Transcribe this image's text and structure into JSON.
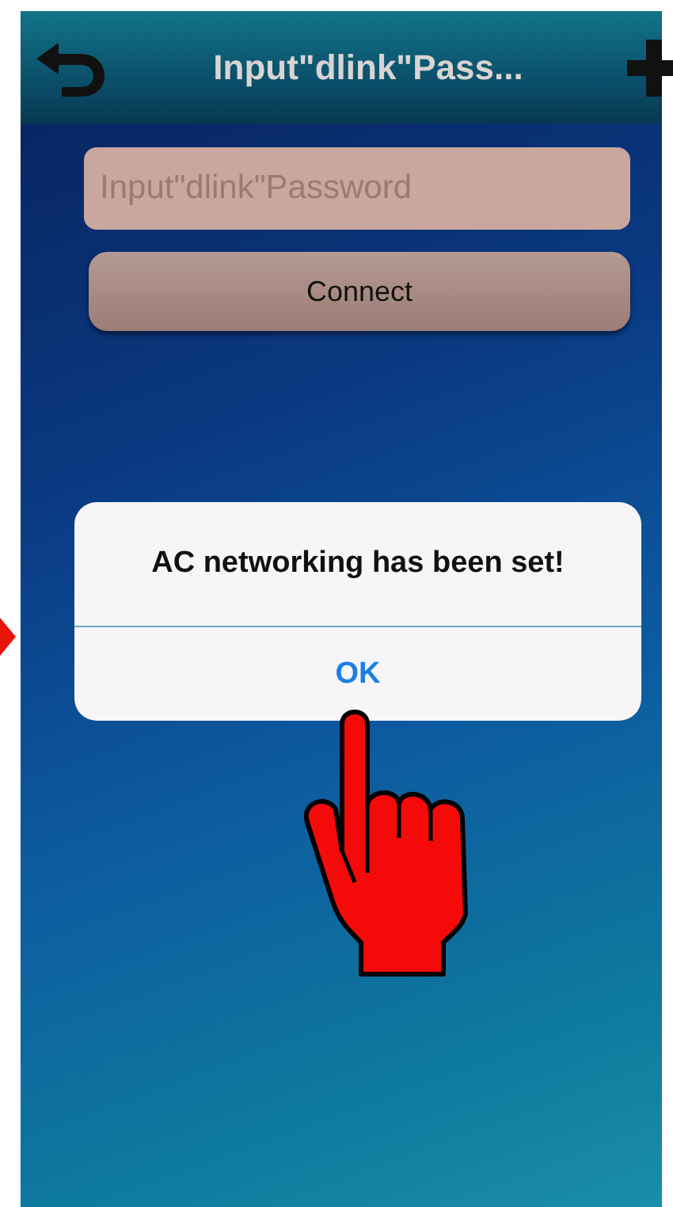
{
  "header": {
    "title": "Input\"dlink\"Pass..."
  },
  "password_field": {
    "placeholder": "Input\"dlink\"Password"
  },
  "connect_button": {
    "label": "Connect"
  },
  "alert": {
    "message": "AC networking has been set!",
    "button": "OK"
  }
}
